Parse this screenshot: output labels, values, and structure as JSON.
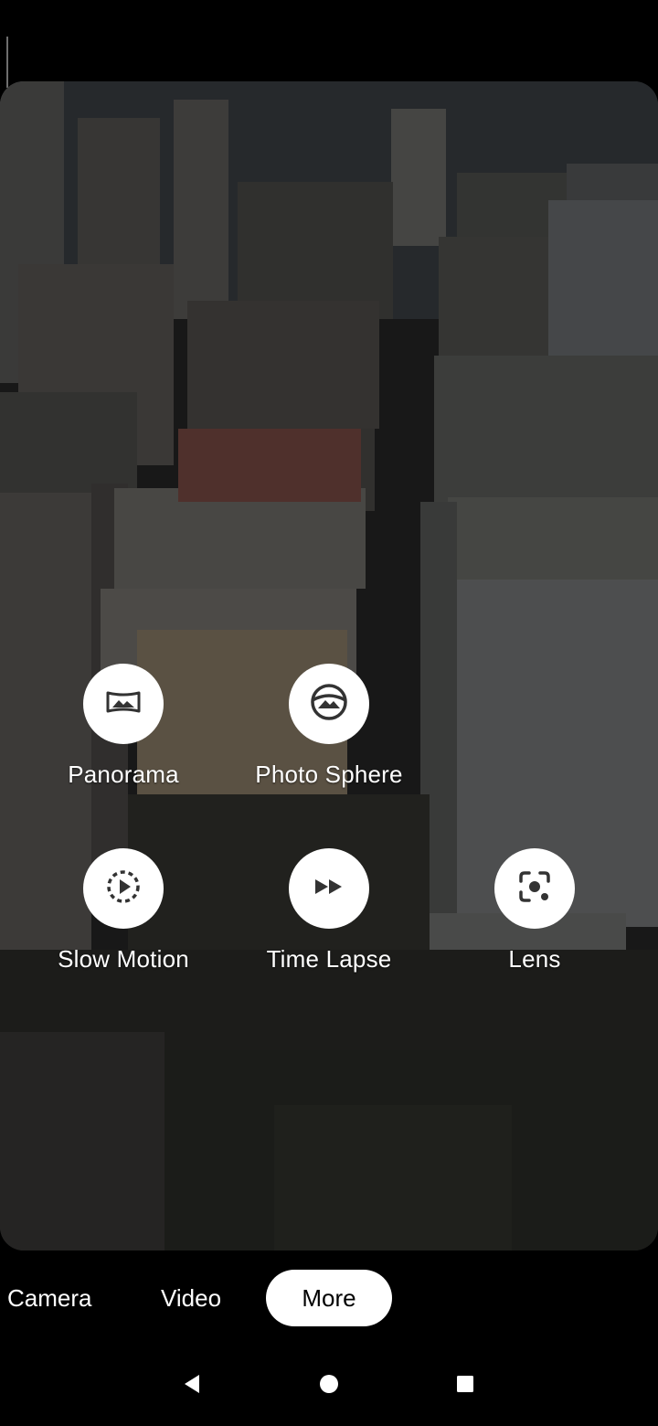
{
  "viewfinder": {
    "overlay_color": "#000000"
  },
  "modes": [
    {
      "id": "panorama",
      "label": "Panorama",
      "icon": "panorama-icon"
    },
    {
      "id": "photo-sphere",
      "label": "Photo Sphere",
      "icon": "photo-sphere-icon"
    },
    {
      "id": "slow-motion",
      "label": "Slow Motion",
      "icon": "slow-motion-icon"
    },
    {
      "id": "time-lapse",
      "label": "Time Lapse",
      "icon": "time-lapse-icon"
    },
    {
      "id": "lens",
      "label": "Lens",
      "icon": "lens-icon"
    }
  ],
  "mode_bar": {
    "camera_label": "Camera",
    "video_label": "Video",
    "more_label": "More",
    "selected": "More"
  },
  "nav": {
    "back_icon": "back-triangle-icon",
    "home_icon": "home-circle-icon",
    "recents_icon": "recents-square-icon"
  },
  "colors": {
    "accent": "#ffffff",
    "background": "#000000"
  }
}
